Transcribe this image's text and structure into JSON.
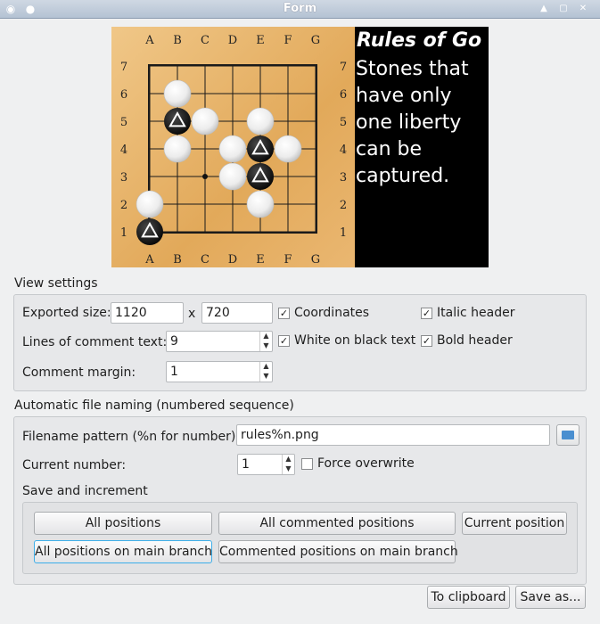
{
  "window": {
    "title": "Form"
  },
  "board": {
    "columns": [
      "A",
      "B",
      "C",
      "D",
      "E",
      "F",
      "G"
    ],
    "rows": [
      "7",
      "6",
      "5",
      "4",
      "3",
      "2",
      "1"
    ],
    "white_stones": [
      "B6",
      "C5",
      "E5",
      "B4",
      "D4",
      "F4",
      "D3",
      "E2",
      "A2"
    ],
    "black_stones_marked": [
      "B5",
      "E4",
      "E3",
      "A1"
    ],
    "hoshi": [
      "C3"
    ]
  },
  "comment": {
    "header": "Rules of Go",
    "lines": [
      "Stones that",
      "have only",
      "one liberty",
      "can be",
      "captured."
    ]
  },
  "view_settings": {
    "title": "View settings",
    "exported_size_label": "Exported size:",
    "width": "1120",
    "x": "x",
    "height": "720",
    "lines_label": "Lines of comment text:",
    "lines_value": "9",
    "margin_label": "Comment margin:",
    "margin_value": "1",
    "coordinates_label": "Coordinates",
    "coordinates_checked": true,
    "white_on_black_label": "White on black text",
    "white_on_black_checked": true,
    "italic_label": "Italic header",
    "italic_checked": true,
    "bold_label": "Bold header",
    "bold_checked": true
  },
  "naming": {
    "title": "Automatic file naming (numbered sequence)",
    "pattern_label": "Filename pattern (%n for number):",
    "pattern_value": "rules%n.png",
    "current_label": "Current number:",
    "current_value": "1",
    "force_label": "Force overwrite",
    "force_checked": false,
    "save_inc_title": "Save and increment",
    "buttons": {
      "all_positions": "All positions",
      "all_commented": "All commented positions",
      "current_position": "Current position",
      "all_main": "All positions on main branch",
      "commented_main": "Commented positions on main branch"
    }
  },
  "footer": {
    "clipboard": "To clipboard",
    "save_as": "Save as..."
  },
  "colors": {
    "accent": "#3daee9",
    "board": "#e8b46a"
  }
}
